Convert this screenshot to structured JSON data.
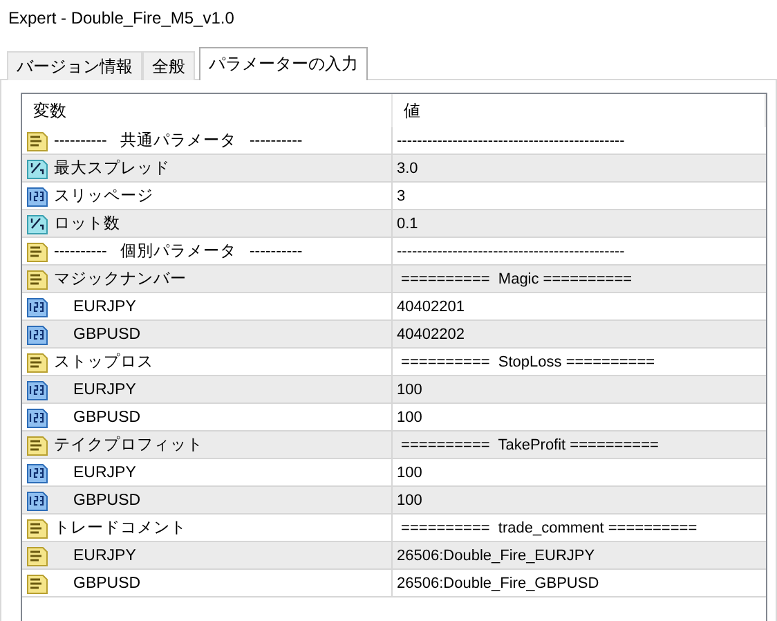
{
  "window": {
    "title": "Expert - Double_Fire_M5_v1.0"
  },
  "tabs": [
    {
      "label": "バージョン情報",
      "selected": false
    },
    {
      "label": "全般",
      "selected": false
    },
    {
      "label": "パラメーターの入力",
      "selected": true
    }
  ],
  "table": {
    "columns": [
      "変数",
      "値"
    ],
    "rows": [
      {
        "kind": "string",
        "name": "----------   共通パラメータ   ----------",
        "value": "---------------------------------------------"
      },
      {
        "kind": "double",
        "name": "最大スプレッド",
        "value": "3.0"
      },
      {
        "kind": "int",
        "name": "スリッページ",
        "value": "3"
      },
      {
        "kind": "double",
        "name": "ロット数",
        "value": "0.1"
      },
      {
        "kind": "string",
        "name": "----------   個別パラメータ   ----------",
        "value": "---------------------------------------------"
      },
      {
        "kind": "string",
        "name": "マジックナンバー",
        "value": " ==========  Magic ==========",
        "children": [
          {
            "kind": "int",
            "name": "EURJPY",
            "value": "40402201"
          },
          {
            "kind": "int",
            "name": "GBPUSD",
            "value": "40402202"
          }
        ]
      },
      {
        "kind": "string",
        "name": "ストップロス",
        "value": " ==========  StopLoss ==========",
        "children": [
          {
            "kind": "int",
            "name": "EURJPY",
            "value": "100"
          },
          {
            "kind": "int",
            "name": "GBPUSD",
            "value": "100"
          }
        ]
      },
      {
        "kind": "string",
        "name": "テイクプロフィット",
        "value": " ==========  TakeProfit ==========",
        "children": [
          {
            "kind": "int",
            "name": "EURJPY",
            "value": "100"
          },
          {
            "kind": "int",
            "name": "GBPUSD",
            "value": "100"
          }
        ]
      },
      {
        "kind": "string",
        "name": "トレードコメント",
        "value": " ==========  trade_comment ==========",
        "children": [
          {
            "kind": "string",
            "name": "EURJPY",
            "value": "26506:Double_Fire_EURJPY"
          },
          {
            "kind": "string",
            "name": "GBPUSD",
            "value": "26506:Double_Fire_GBPUSD"
          }
        ]
      }
    ]
  }
}
